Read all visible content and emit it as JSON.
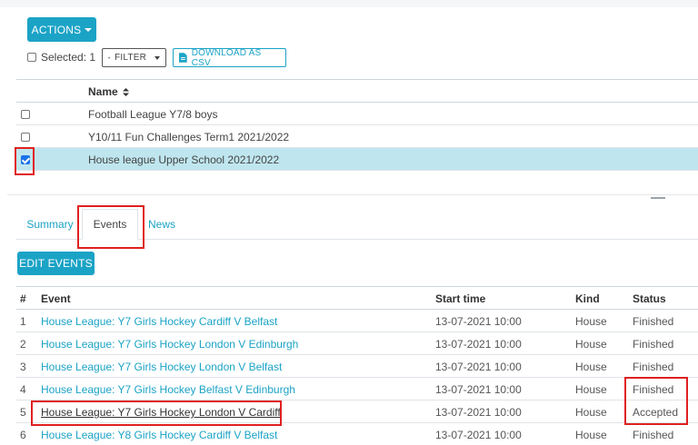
{
  "toolbar": {
    "actions_label": "ACTIONS",
    "selected_label": "Selected: 1",
    "filter_label": "FILTER",
    "download_label": "DOWNLOAD AS CSV"
  },
  "groups_table": {
    "name_header": "Name",
    "sort_icon": "sort-icon",
    "rows": [
      {
        "name": "Football League Y7/8 boys",
        "checked": false
      },
      {
        "name": "Y10/11 Fun Challenges Term1 2021/2022",
        "checked": false
      },
      {
        "name": "House league Upper School 2021/2022",
        "checked": true
      }
    ]
  },
  "tabs": [
    {
      "label": "Summary",
      "active": false
    },
    {
      "label": "Events",
      "active": true
    },
    {
      "label": "News",
      "active": false
    }
  ],
  "edit_events_label": "EDIT EVENTS",
  "events_table": {
    "headers": {
      "num": "#",
      "event": "Event",
      "start": "Start time",
      "kind": "Kind",
      "status": "Status"
    },
    "rows": [
      {
        "num": "1",
        "event": "House League: Y7 Girls Hockey Cardiff V Belfast",
        "start": "13-07-2021 10:00",
        "kind": "House",
        "status": "Finished"
      },
      {
        "num": "2",
        "event": "House League: Y7 Girls Hockey London V Edinburgh",
        "start": "13-07-2021 10:00",
        "kind": "House",
        "status": "Finished"
      },
      {
        "num": "3",
        "event": "House League: Y7 Girls Hockey London V Belfast",
        "start": "13-07-2021 10:00",
        "kind": "House",
        "status": "Finished"
      },
      {
        "num": "4",
        "event": "House League: Y7 Girls Hockey Belfast V Edinburgh",
        "start": "13-07-2021 10:00",
        "kind": "House",
        "status": "Finished"
      },
      {
        "num": "5",
        "event": "House League: Y7 Girls Hockey London V Cardiff",
        "start": "13-07-2021 10:00",
        "kind": "House",
        "status": "Accepted"
      },
      {
        "num": "6",
        "event": "House League: Y8 Girls Hockey Cardiff V Belfast",
        "start": "13-07-2021 10:00",
        "kind": "House",
        "status": "Finished"
      }
    ]
  },
  "colors": {
    "accent": "#1ba3c6",
    "selected_row": "#bfe6ef",
    "highlight": "#e02020"
  }
}
